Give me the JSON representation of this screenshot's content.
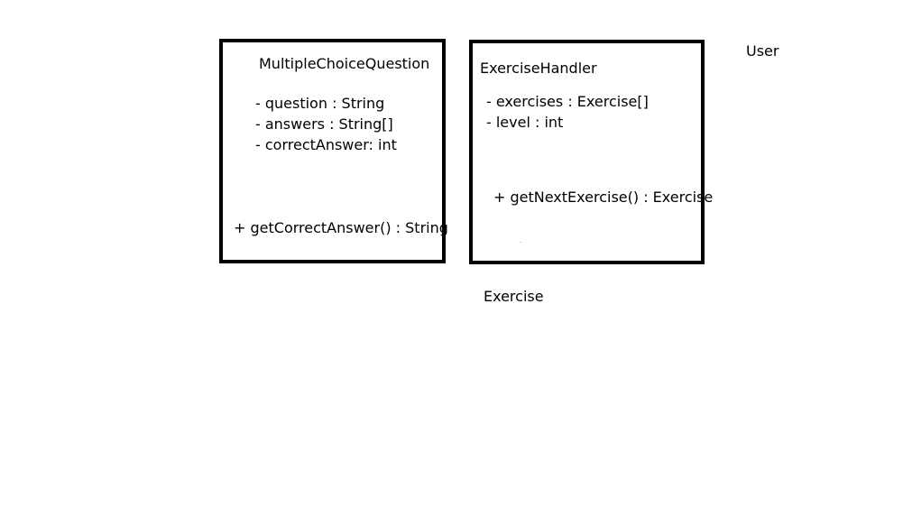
{
  "diagram": {
    "classes": [
      {
        "name": "MultipleChoiceQuestion",
        "attributes": [
          "- question : String",
          "- answers : String[]",
          "- correctAnswer: int"
        ],
        "methods": [
          "+ getCorrectAnswer() : String"
        ]
      },
      {
        "name": "ExerciseHandler",
        "attributes": [
          "- exercises : Exercise[]",
          "- level : int"
        ],
        "methods": [
          "+ getNextExercise() : Exercise"
        ]
      }
    ],
    "loose_labels": {
      "user": "User",
      "exercise": "Exercise"
    }
  }
}
